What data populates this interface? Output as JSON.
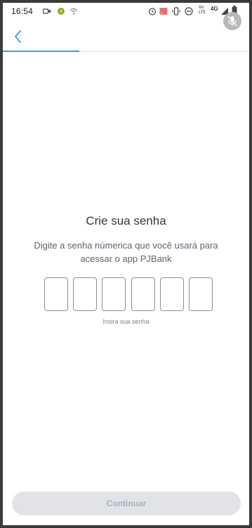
{
  "status_bar": {
    "time": "16:54",
    "network_label": "Vo LTE",
    "network_type": "4G",
    "icons_left": [
      "video-icon",
      "android-icon",
      "wifi-icon"
    ],
    "icons_right": [
      "alarm-icon",
      "cast-icon",
      "vibrate-icon",
      "dnd-icon",
      "signal-icon",
      "battery-icon"
    ]
  },
  "header": {
    "back_icon": "chevron-left-icon",
    "mic_icon": "mic-off-icon",
    "progress": 0.31
  },
  "content": {
    "title": "Crie sua senha",
    "subtitle": "Digite a senha númerica que você usará para acessar o app PJBank",
    "pin_length": 6,
    "pin_hint": "Insira sua senha"
  },
  "footer": {
    "continue_label": "Continuar"
  },
  "colors": {
    "accent": "#2ea6c9",
    "button_disabled_bg": "#e1e3e8",
    "button_disabled_text": "#a9adb5",
    "title": "#333840",
    "subtitle": "#5d6470"
  }
}
